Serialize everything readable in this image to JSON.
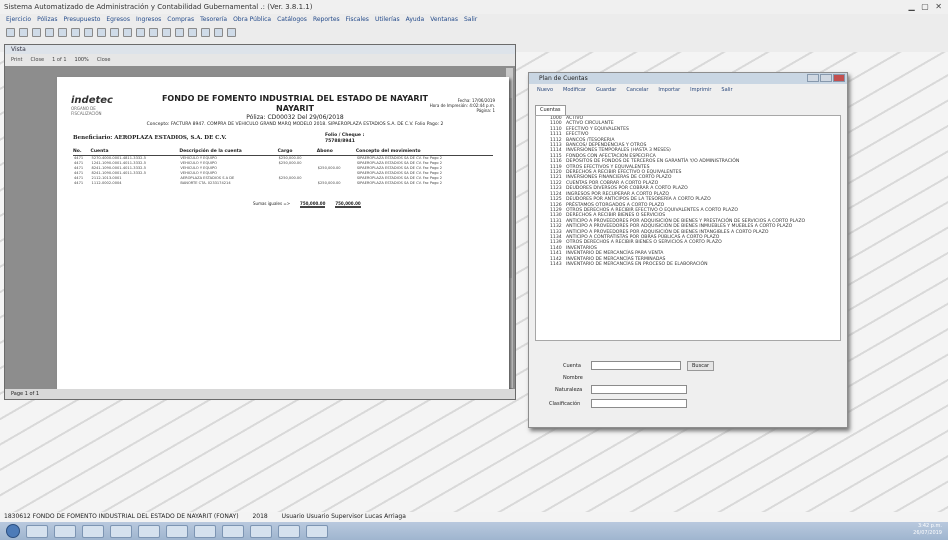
{
  "window": {
    "title": "Sistema Automatizado de Administración y Contabilidad Gubernamental .: (Ver. 3.8.1.1)"
  },
  "menu": [
    "Ejercicio",
    "Pólizas",
    "Presupuesto",
    "Egresos",
    "Ingresos",
    "Compras",
    "Tesorería",
    "Obra Pública",
    "Catálogos",
    "Reportes",
    "Fiscales",
    "Utilerías",
    "Ayuda",
    "Ventanas",
    "Salir"
  ],
  "viewer": {
    "title": "Vista",
    "toolbar": {
      "print": "Print",
      "close": "Close",
      "page": "1 of 1",
      "zoom": "100%",
      "close2": "Close"
    },
    "status": "Page 1 of 1"
  },
  "report": {
    "logo": "indetec",
    "logo_sub": [
      "ORGANO DE",
      "FISCALIZACIÓN"
    ],
    "title": "FONDO DE FOMENTO INDUSTRIAL DEL ESTADO DE NAYARIT",
    "subtitle": "NAYARIT",
    "poliza": "Póliza: CD00032  Del 29/06/2018",
    "concepto": "Concepto: FACTURA 8947. COMPRA DE VEHICULO GRAND MARQ MODELO 2018. SIPAEROPLAZA ESTADIOS S.A. DE C.V. Folio Pago: 2",
    "fecha": [
      "Fecha:",
      "17/06/2019",
      "Hora de Impresión:",
      "4:02:44 p.m.",
      "Página:",
      "1"
    ],
    "beneficiario_label": "Beneficiario:",
    "beneficiario": "AEROPLAZA ESTADIOS, S.A. DE C.V.",
    "folio": [
      "Folio / Cheque :",
      "75788/8941"
    ],
    "columns": [
      "No.",
      "Cuenta",
      "Descripción de la cuenta",
      "Cargo",
      "Abono",
      "Concepto del movimiento"
    ],
    "rows": [
      [
        "4471",
        "5270-4000-0001-4811-3332-5",
        "VEHICULO Y EQUIPO",
        "$250,000.00",
        "",
        "SIPAEROPLAZA ESTADIOS SA DE CV. Fac Pago 2"
      ],
      [
        "4471",
        "1241-1090-0001-4011-3332-5",
        "VEHICULO Y EQUIPO",
        "$250,000.00",
        "",
        "SIPAEROPLAZA ESTADIOS SA DE CV. Fac Pago 2"
      ],
      [
        "4471",
        "8241-1090-0001-4011-3332-5",
        "VEHICULO Y EQUIPO",
        "",
        "$250,000.00",
        "SIPAEROPLAZA ESTADIOS SA DE CV. Fac Pago 2"
      ],
      [
        "4471",
        "8241-1090-0001-4011-3332-5",
        "VEHICULO Y EQUIPO",
        "",
        "",
        "SIPAEROPLAZA ESTADIOS SA DE CV. Fac Pago 2"
      ],
      [
        "4471",
        "2112-1013-0001",
        "AEROPLAZA ESTADIOS S A DE",
        "$250,000.00",
        "",
        "SIPAEROPLAZA ESTADIOS SA DE CV. Fac Pago 2"
      ],
      [
        "4471",
        "1112-0002-0004",
        "BANORTE CTA. 0233174214",
        "",
        "$250,000.00",
        "SIPAEROPLAZA ESTADIOS SA DE CV. Fac Pago 2"
      ]
    ],
    "sums_label": "Sumas iguales =>",
    "sum_cargo": "750,000.00",
    "sum_abono": "750,000.00"
  },
  "plan": {
    "title": "Plan de Cuentas",
    "toolbar": [
      "Nuevo",
      "Modificar",
      "Guardar",
      "Cancelar",
      "Importar",
      "Imprimir",
      "Salir"
    ],
    "tab": "Cuentas",
    "accounts": [
      [
        "1000",
        "ACTIVO"
      ],
      [
        "1100",
        "ACTIVO CIRCULANTE"
      ],
      [
        "1110",
        "EFECTIVO Y EQUIVALENTES"
      ],
      [
        "1111",
        "EFECTIVO"
      ],
      [
        "1112",
        "BANCOS /TESORERIA"
      ],
      [
        "1113",
        "BANCOS/ DEPENDENCIAS Y OTROS"
      ],
      [
        "1114",
        "INVERSIONES TEMPORALES (HASTA 3 MESES)"
      ],
      [
        "1115",
        "FONDOS CON AFECTACION ESPECIFICA"
      ],
      [
        "1116",
        "DEPÓSITOS DE FONDOS DE TERCEROS EN GARANTÍA Y/O ADMINISTRACIÓN"
      ],
      [
        "1119",
        "OTROS EFECTIVOS Y EQUIVALENTES"
      ],
      [
        "1120",
        "DERECHOS A RECIBIR EFECTIVO O EQUIVALENTES"
      ],
      [
        "1121",
        "INVERSIONES FINANCIERAS DE CORTO PLAZO"
      ],
      [
        "1122",
        "CUENTAS POR COBRAR A CORTO PLAZO"
      ],
      [
        "1123",
        "DEUDORES DIVERSOS POR COBRAR A CORTO PLAZO"
      ],
      [
        "1124",
        "INGRESOS POR RECUPERAR A CORTO PLAZO"
      ],
      [
        "1125",
        "DEUDORES POR ANTICIPOS DE LA TESORERÍA A CORTO PLAZO"
      ],
      [
        "1126",
        "PRÉSTAMOS OTORGADOS A CORTO PLAZO"
      ],
      [
        "1129",
        "OTROS DERECHOS A RECIBIR EFECTIVO O EQUIVALENTES A CORTO PLAZO"
      ],
      [
        "1130",
        "DERECHOS A RECIBIR BIENES O SERVICIOS"
      ],
      [
        "1131",
        "ANTICIPO A PROVEEDORES POR ADQUISICIÓN DE BIENES Y PRESTACIÓN DE SERVICIOS A CORTO PLAZO"
      ],
      [
        "1132",
        "ANTICIPO A PROVEEDORES POR ADQUISICIÓN DE BIENES INMUEBLES Y MUEBLES A CORTO PLAZO"
      ],
      [
        "1133",
        "ANTICIPO A PROVEEDORES POR ADQUISICIÓN DE BIENES INTANGIBLES A CORTO PLAZO"
      ],
      [
        "1134",
        "ANTICIPO A CONTRATISTAS POR OBRAS PÚBLICAS A CORTO PLAZO"
      ],
      [
        "1139",
        "OTROS DERECHOS A RECIBIR BIENES O SERVICIOS A CORTO PLAZO"
      ],
      [
        "1140",
        "INVENTARIOS"
      ],
      [
        "1141",
        "INVENTARIO DE MERCANCÍAS PARA VENTA"
      ],
      [
        "1142",
        "INVENTARIO DE MERCANCÍAS TERMINADAS"
      ],
      [
        "1143",
        "INVENTARIO DE MERCANCÍAS EN PROCESO DE ELABORACIÓN"
      ]
    ],
    "form": {
      "cuenta": "Cuenta",
      "nombre": "Nombre",
      "naturaleza": "Naturaleza",
      "clasificacion": "Clasificación",
      "search_btn": "Buscar"
    }
  },
  "infobar": {
    "entity": "1830612 FONDO DE FOMENTO INDUSTRIAL DEL ESTADO DE NAYARIT (FONAY)",
    "year": "2018",
    "user": "Usuario Usuario Supervisor Lucas Arriaga"
  },
  "clock": {
    "time": "3:42 p.m.",
    "date": "26/07/2019"
  }
}
